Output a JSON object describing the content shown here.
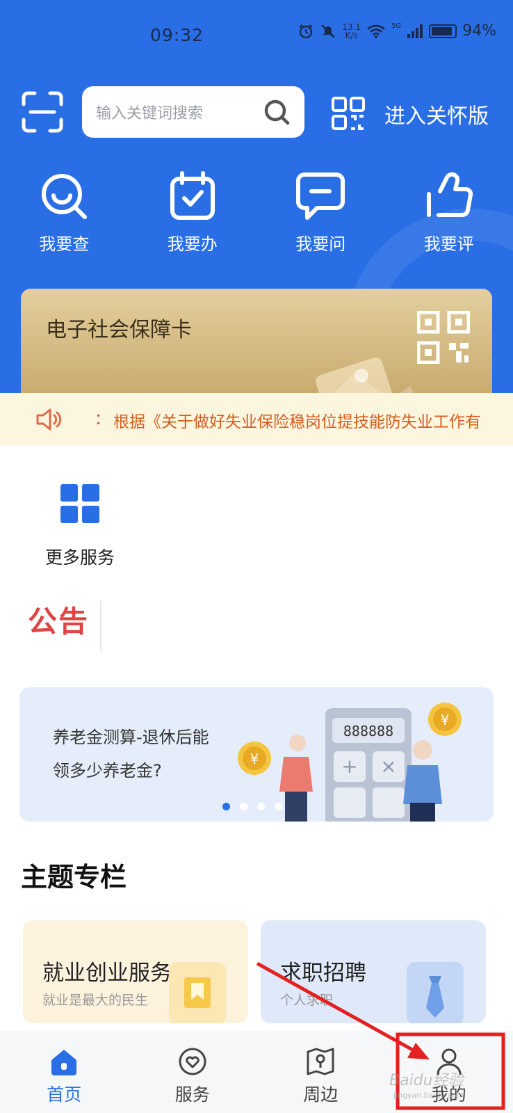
{
  "status_bar": {
    "time": "09:32",
    "net_speed_value": "13.1",
    "net_speed_unit": "K/s",
    "network": "5G",
    "battery": "94%"
  },
  "header": {
    "search_placeholder": "输入关键词搜索",
    "care_mode_label": "进入关怀版"
  },
  "quick_actions": [
    {
      "label": "我要查",
      "icon": "search-smile-icon"
    },
    {
      "label": "我要办",
      "icon": "calendar-check-icon"
    },
    {
      "label": "我要问",
      "icon": "chat-bubble-icon"
    },
    {
      "label": "我要评",
      "icon": "thumbs-up-icon"
    }
  ],
  "social_card": {
    "title": "电子社会保障卡"
  },
  "notice": {
    "separator": "：",
    "text": "根据《关于做好失业保险稳岗位提技能防失业工作有"
  },
  "more_services": {
    "label": "更多服务"
  },
  "announcement": {
    "label": "公告"
  },
  "banner": {
    "line1": "养老金测算-退休后能",
    "line2": "领多少养老金?",
    "calculator_display": "888888",
    "coin_symbol": "¥",
    "active_dot": 0,
    "dot_count": 4
  },
  "themes": {
    "title": "主题专栏",
    "items": [
      {
        "title": "就业创业服务",
        "subtitle": "就业是最大的民生"
      },
      {
        "title": "求职招聘",
        "subtitle": "个人求职"
      }
    ]
  },
  "tabbar": [
    {
      "label": "首页",
      "active": true
    },
    {
      "label": "服务",
      "active": false
    },
    {
      "label": "周边",
      "active": false
    },
    {
      "label": "我的",
      "active": false
    }
  ],
  "watermark": {
    "brand": "Baidu经验",
    "url": "jingyan.baidu.com"
  },
  "colors": {
    "primary": "#2a6ee6",
    "highlight": "#e52020",
    "notice_text": "#d55c1f"
  }
}
